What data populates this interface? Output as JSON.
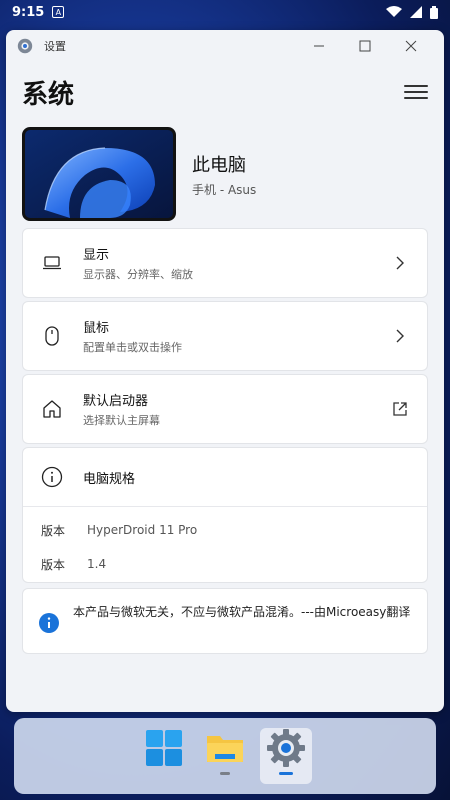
{
  "status_bar": {
    "time": "9:15"
  },
  "window": {
    "title": "设置",
    "controls": {
      "minimize": "–",
      "maximize": "□",
      "close": "✕"
    }
  },
  "page": {
    "title": "系统"
  },
  "device": {
    "name": "此电脑",
    "model": "手机 - Asus"
  },
  "settings": [
    {
      "icon": "laptop-icon",
      "title": "显示",
      "subtitle": "显示器、分辨率、缩放",
      "trail": "chevron-right-icon"
    },
    {
      "icon": "mouse-icon",
      "title": "鼠标",
      "subtitle": "配置单击或双击操作",
      "trail": "chevron-right-icon"
    },
    {
      "icon": "home-icon",
      "title": "默认启动器",
      "subtitle": "选择默认主屏幕",
      "trail": "open-external-icon"
    }
  ],
  "specs": {
    "title": "电脑规格",
    "rows": [
      {
        "key": "版本",
        "value": "HyperDroid 11 Pro"
      },
      {
        "key": "版本",
        "value": "1.4"
      }
    ]
  },
  "notice": {
    "text": "本产品与微软无关，不应与微软产品混淆。---由Microeasy翻译"
  },
  "dock": {
    "apps": [
      {
        "name": "start-icon"
      },
      {
        "name": "file-explorer-icon"
      },
      {
        "name": "settings-icon"
      }
    ]
  },
  "colors": {
    "accent": "#1a73d9",
    "window_bg": "#f1f3f7",
    "card_bg": "#ffffff"
  }
}
